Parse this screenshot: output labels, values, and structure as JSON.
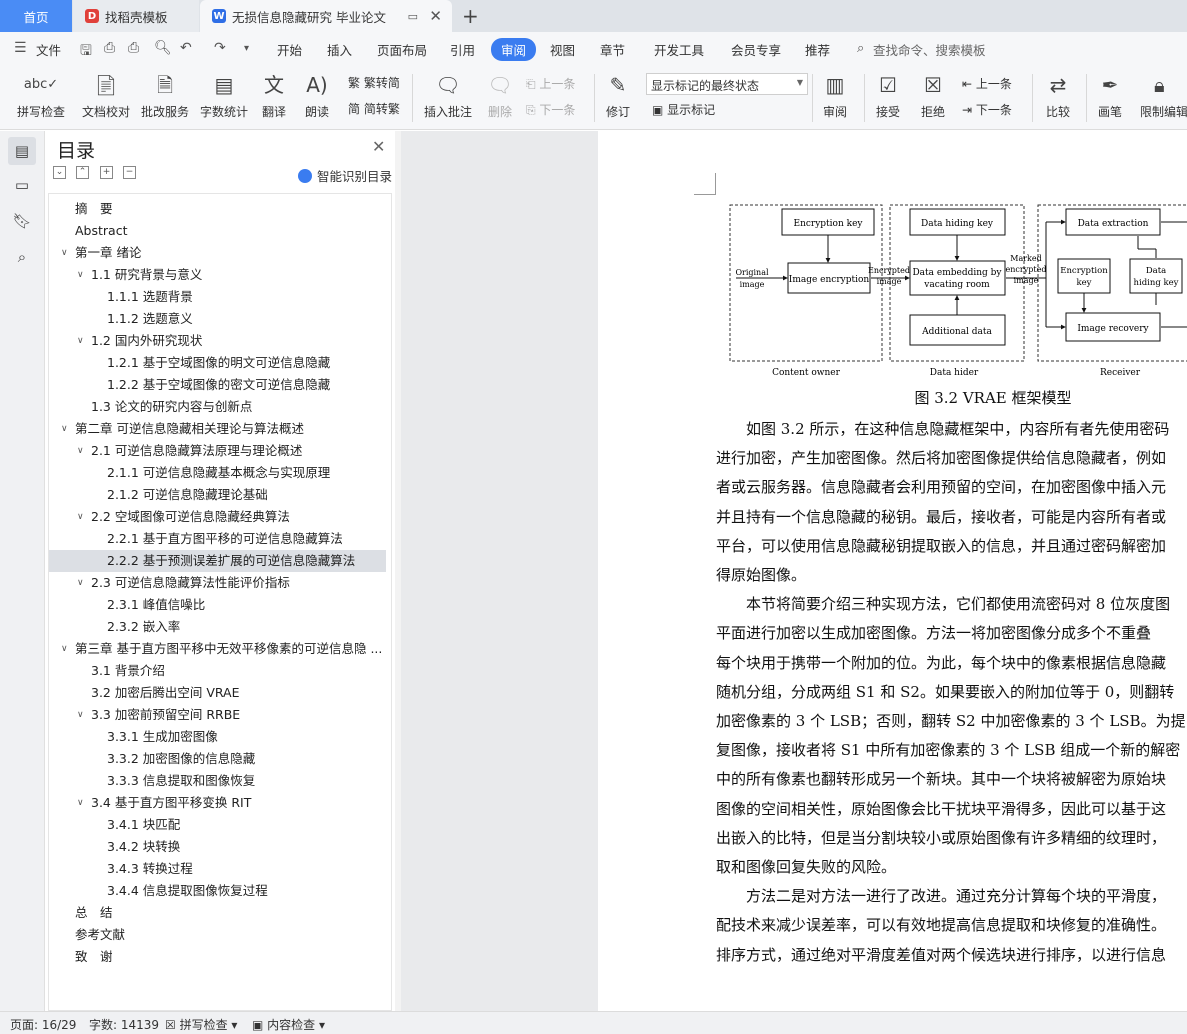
{
  "tabs": {
    "home": "首页",
    "template": "找稻壳模板",
    "doc": "无损信息隐藏研究 毕业论文"
  },
  "menu": {
    "file": "文件",
    "items": [
      "开始",
      "插入",
      "页面布局",
      "引用",
      "审阅",
      "视图",
      "章节",
      "开发工具",
      "会员专享",
      "推荐"
    ],
    "active": "审阅",
    "search_placeholder": "查找命令、搜索模板"
  },
  "ribbon": {
    "spell": "拼写检查",
    "proof": "文档校对",
    "batch": "批改服务",
    "wordcount": "字数统计",
    "translate": "翻译",
    "read": "朗读",
    "to_trad": "繁转简",
    "to_simp": "简转繁",
    "insert_comment": "插入批注",
    "delete": "删除",
    "prev_comment": "上一条",
    "next_comment": "下一条",
    "revise": "修订",
    "markup_dropdown": "显示标记的最终状态",
    "show_markup": "显示标记",
    "review": "审阅",
    "accept": "接受",
    "reject": "拒绝",
    "prev_change": "上一条",
    "next_change": "下一条",
    "compare": "比较",
    "pen": "画笔",
    "restrict": "限制编辑"
  },
  "toc": {
    "title": "目录",
    "smart": "智能识别目录",
    "items": [
      {
        "text": "摘　要",
        "level": 0,
        "arrow": false
      },
      {
        "text": "Abstract",
        "level": 0,
        "arrow": false
      },
      {
        "text": "第一章  绪论",
        "level": 0,
        "arrow": true
      },
      {
        "text": "1.1  研究背景与意义",
        "level": 1,
        "arrow": true
      },
      {
        "text": "1.1.1 选题背景",
        "level": 2,
        "arrow": false
      },
      {
        "text": "1.1.2 选题意义",
        "level": 2,
        "arrow": false
      },
      {
        "text": "1.2  国内外研究现状",
        "level": 1,
        "arrow": true
      },
      {
        "text": "1.2.1  基于空域图像的明文可逆信息隐藏",
        "level": 2,
        "arrow": false
      },
      {
        "text": "1.2.2  基于空域图像的密文可逆信息隐藏",
        "level": 2,
        "arrow": false
      },
      {
        "text": "1.3  论文的研究内容与创新点",
        "level": 1,
        "arrow": false
      },
      {
        "text": "第二章  可逆信息隐藏相关理论与算法概述",
        "level": 0,
        "arrow": true
      },
      {
        "text": "2.1  可逆信息隐藏算法原理与理论概述",
        "level": 1,
        "arrow": true
      },
      {
        "text": "2.1.1  可逆信息隐藏基本概念与实现原理",
        "level": 2,
        "arrow": false
      },
      {
        "text": "2.1.2  可逆信息隐藏理论基础",
        "level": 2,
        "arrow": false
      },
      {
        "text": "2.2  空域图像可逆信息隐藏经典算法",
        "level": 1,
        "arrow": true
      },
      {
        "text": "2.2.1  基于直方图平移的可逆信息隐藏算法",
        "level": 2,
        "arrow": false
      },
      {
        "text": "2.2.2  基于预测误差扩展的可逆信息隐藏算法",
        "level": 2,
        "arrow": false,
        "selected": true
      },
      {
        "text": "2.3  可逆信息隐藏算法性能评价指标",
        "level": 1,
        "arrow": true
      },
      {
        "text": "2.3.1  峰值信噪比",
        "level": 2,
        "arrow": false
      },
      {
        "text": "2.3.2  嵌入率",
        "level": 2,
        "arrow": false
      },
      {
        "text": "第三章  基于直方图平移中无效平移像素的可逆信息隐 ...",
        "level": 0,
        "arrow": true
      },
      {
        "text": "3.1 背景介绍",
        "level": 1,
        "arrow": false
      },
      {
        "text": "3.2 加密后腾出空间 VRAE",
        "level": 1,
        "arrow": false
      },
      {
        "text": "3.3 加密前预留空间 RRBE",
        "level": 1,
        "arrow": true
      },
      {
        "text": "3.3.1 生成加密图像",
        "level": 2,
        "arrow": false
      },
      {
        "text": "3.3.2 加密图像的信息隐藏",
        "level": 2,
        "arrow": false
      },
      {
        "text": "3.3.3 信息提取和图像恢复",
        "level": 2,
        "arrow": false
      },
      {
        "text": "3.4 基于直方图平移变换 RIT",
        "level": 1,
        "arrow": true
      },
      {
        "text": "3.4.1 块匹配",
        "level": 2,
        "arrow": false
      },
      {
        "text": "3.4.2 块转换",
        "level": 2,
        "arrow": false
      },
      {
        "text": "3.4.3 转换过程",
        "level": 2,
        "arrow": false
      },
      {
        "text": "3.4.4 信息提取图像恢复过程",
        "level": 2,
        "arrow": false
      },
      {
        "text": "总　结",
        "level": 0,
        "arrow": false
      },
      {
        "text": "参考文献",
        "level": 0,
        "arrow": false
      },
      {
        "text": "致　谢",
        "level": 0,
        "arrow": false
      }
    ]
  },
  "figure": {
    "caption": "图 3.2 VRAE 框架模型",
    "content_owner": "Content owner",
    "data_hider": "Data hider",
    "receiver": "Receiver",
    "encryption_key": "Encryption key",
    "image_encryption": "Image encryption",
    "original_image_1": "Original",
    "original_image_2": "image",
    "encrypted_image_1": "Encrypted",
    "encrypted_image_2": "image",
    "data_hiding_key": "Data hiding key",
    "data_embedding_1": "Data embedding by",
    "data_embedding_2": "vacating room",
    "additional_data": "Additional data",
    "marked_1": "Marked",
    "marked_2": "encrypted",
    "marked_3": "image",
    "data_extraction": "Data extraction",
    "enc_key_1": "Encryption",
    "enc_key_2": "key",
    "dh_key_1": "Data",
    "dh_key_2": "hiding key",
    "image_recovery": "Image recovery"
  },
  "paragraphs": [
    "　　如图 3.2 所示，在这种信息隐藏框架中，内容所有者先使用密码",
    "进行加密，产生加密图像。然后将加密图像提供给信息隐藏者，例如",
    "者或云服务器。信息隐藏者会利用预留的空间，在加密图像中插入元",
    "并且持有一个信息隐藏的秘钥。最后，接收者，可能是内容所有者或",
    "平台，可以使用信息隐藏秘钥提取嵌入的信息，并且通过密码解密加",
    "得原始图像。",
    "　　本节将简要介绍三种实现方法，它们都使用流密码对 8 位灰度图",
    "平面进行加密以生成加密图像。方法一将加密图像分成多个不重叠",
    "每个块用于携带一个附加的位。为此，每个块中的像素根据信息隐藏",
    "随机分组，分成两组 S1 和 S2。如果要嵌入的附加位等于 0，则翻转",
    "加密像素的 3 个 LSB；否则，翻转 S2 中加密像素的 3 个 LSB。为提",
    "复图像，接收者将 S1 中所有加密像素的 3 个 LSB 组成一个新的解密",
    "中的所有像素也翻转形成另一个新块。其中一个块将被解密为原始块",
    "图像的空间相关性，原始图像会比干扰块平滑得多，因此可以基于这",
    "出嵌入的比特，但是当分割块较小或原始图像有许多精细的纹理时，",
    "取和图像回复失败的风险。",
    "　　方法二是对方法一进行了改进。通过充分计算每个块的平滑度，",
    "配技术来减少误差率，可以有效地提高信息提取和块修复的准确性。",
    "排序方式，通过绝对平滑度差值对两个候选块进行排序，以进行信息"
  ],
  "status": {
    "page": "页面: 16/29",
    "words": "字数: 14139",
    "spell": "拼写检查",
    "content": "内容检查"
  },
  "colors": {
    "accent": "#3a7cf0",
    "home_tab": "#4a8cf5"
  }
}
